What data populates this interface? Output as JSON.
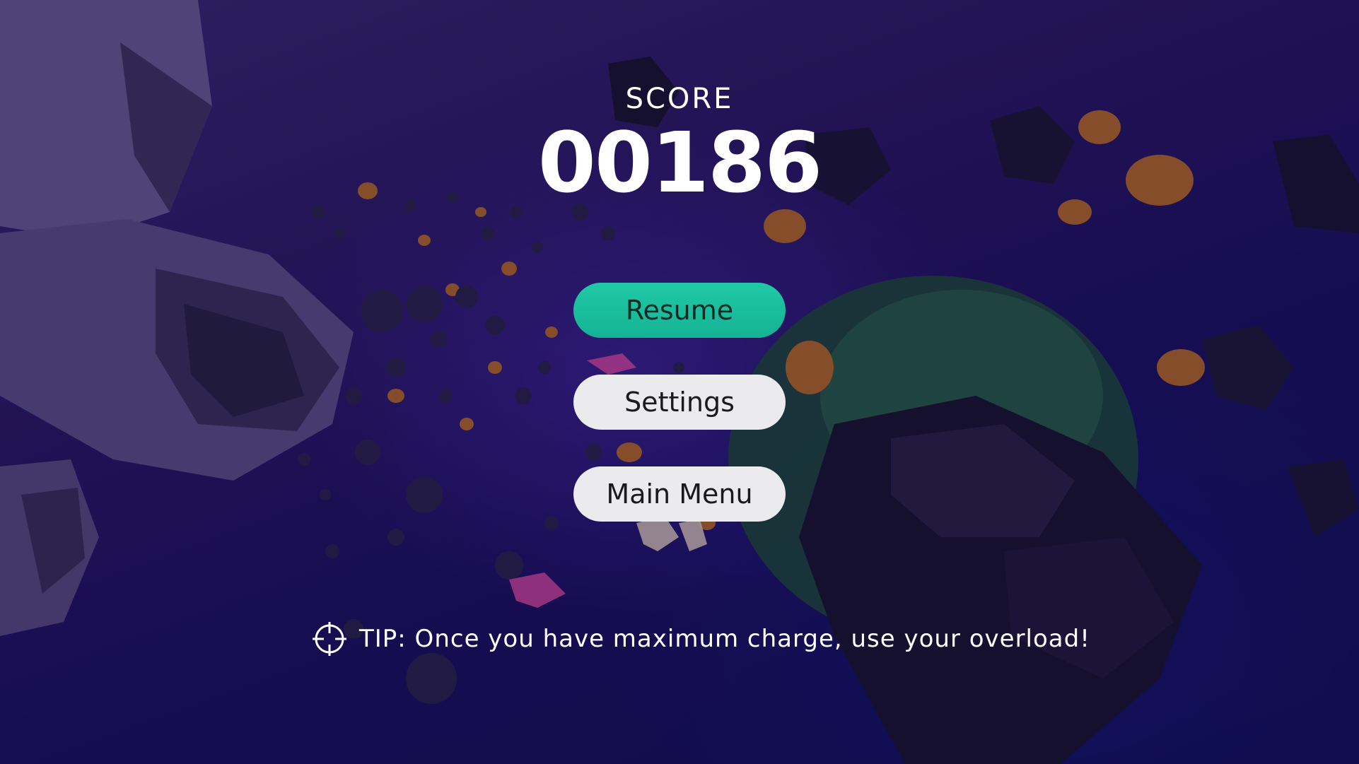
{
  "score": {
    "label": "SCORE",
    "value": "00186"
  },
  "menu": {
    "resume_label": "Resume",
    "settings_label": "Settings",
    "main_menu_label": "Main Menu",
    "resume_color": "#1abf9f",
    "button_color": "#ebebee"
  },
  "tip": {
    "icon": "crosshair-icon",
    "text": "TIP: Once you have maximum charge, use your overload!"
  }
}
